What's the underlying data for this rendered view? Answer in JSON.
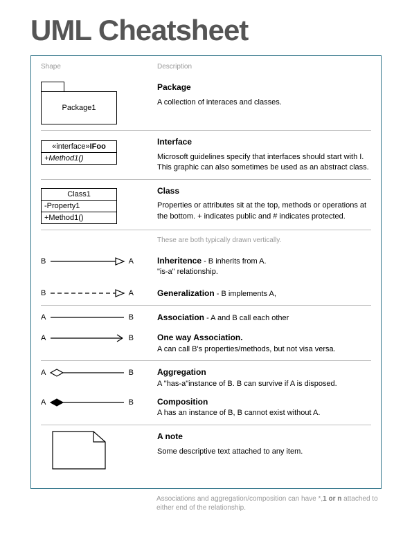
{
  "title": "UML Cheatsheet",
  "headers": {
    "shape": "Shape",
    "description": "Description"
  },
  "package": {
    "label": "Package1",
    "title": "Package",
    "desc": "A collection of interaces and classes."
  },
  "interface": {
    "stereotype": "«interface»",
    "name": "IFoo",
    "method": "+Method1()",
    "title": "Interface",
    "desc": "Microsoft guidelines specify that interfaces should start with I. This graphic can also sometimes be used as an abstract class."
  },
  "class": {
    "name": "Class1",
    "prop": "-Property1",
    "method": "+Method1()",
    "title": "Class",
    "desc": "Properties or attributes sit at the top, methods or operations at the bottom. + indicates public and # indicates protected."
  },
  "relnote": "These are both typically drawn vertically.",
  "inheritence": {
    "left": "B",
    "right": "A",
    "title": "Inheritence",
    "tail": " - B inherits from A.",
    "sub": "\"is-a\" relationship."
  },
  "generalization": {
    "left": "B",
    "right": "A",
    "title": "Generalization",
    "tail": " - B implements A,"
  },
  "association": {
    "left": "A",
    "right": "B",
    "title": "Association",
    "tail": " - A and B call each other"
  },
  "oneway": {
    "left": "A",
    "right": "B",
    "title": "One way Association.",
    "sub": "A can call B's properties/methods, but not visa versa."
  },
  "aggregation": {
    "left": "A",
    "right": "B",
    "title": "Aggregation",
    "sub": "A \"has-a\"instance of B. B can survive if A is disposed."
  },
  "composition": {
    "left": "A",
    "right": "B",
    "title": "Composition",
    "sub": "A has an instance of B, B cannot exist without A."
  },
  "note": {
    "title": "A note",
    "desc": "Some descriptive text attached to any item."
  },
  "footnote": {
    "pre": "Associations and aggregation/composition can have *,",
    "bold": "1 or n",
    "post": " attached to either end of the relationship."
  }
}
